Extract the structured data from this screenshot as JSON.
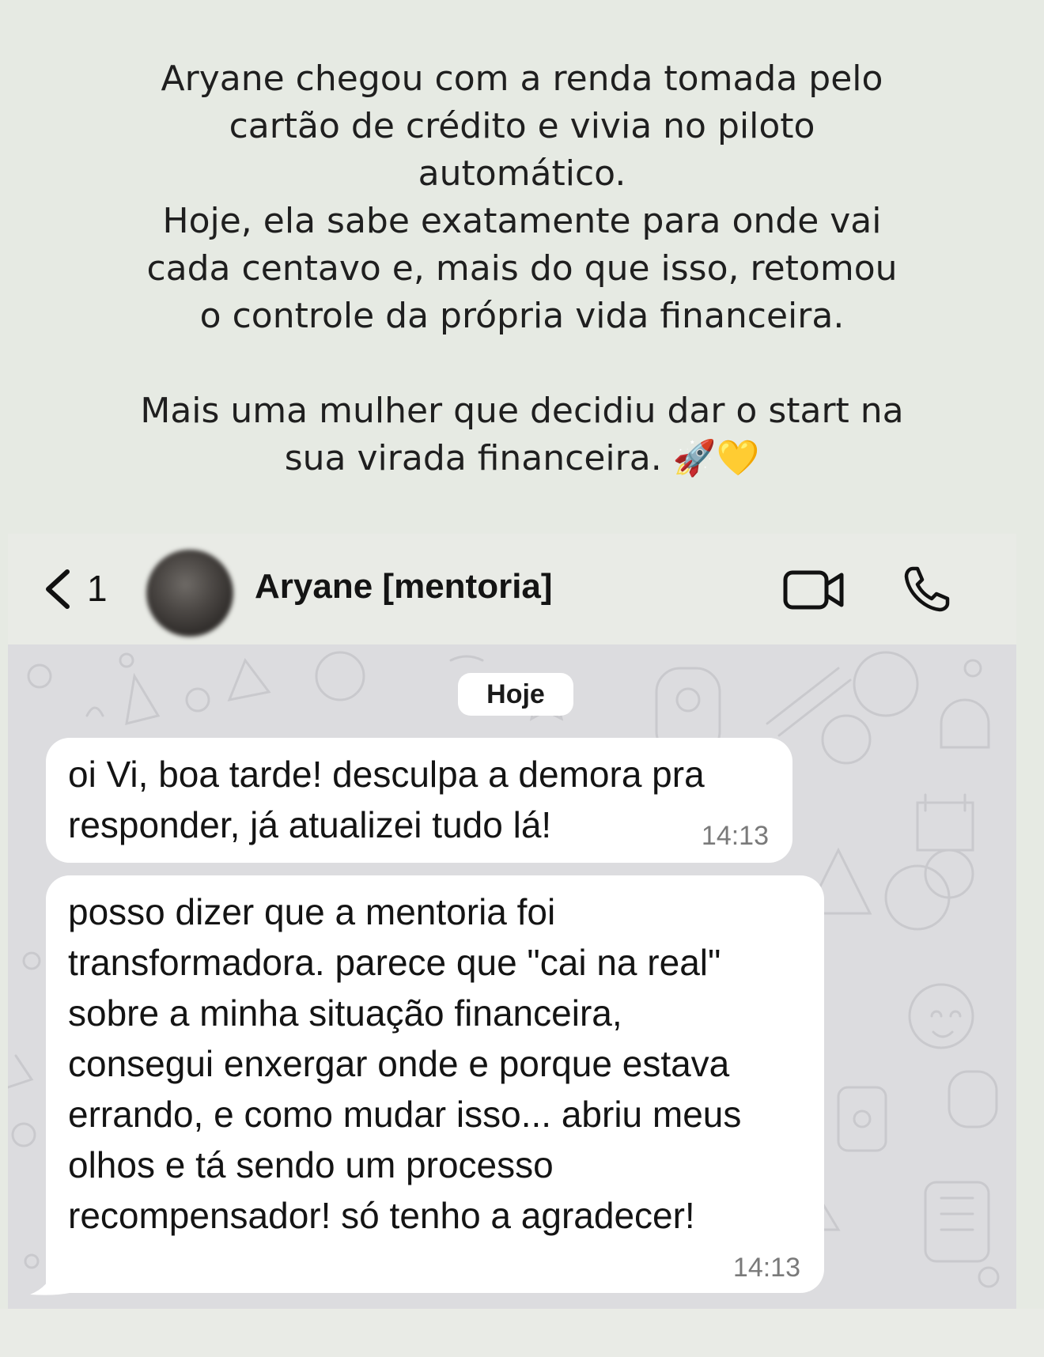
{
  "caption": {
    "para1_lines": [
      "Aryane chegou com a renda tomada pelo",
      "cartão de crédito e vivia no piloto",
      "automático.",
      "Hoje, ela sabe exatamente para onde vai",
      "cada centavo e, mais do que isso, retomou",
      "o controle da própria vida financeira."
    ],
    "para2_lines": [
      "Mais uma mulher que decidiu dar o start na",
      "sua virada financeira. 🚀💛"
    ]
  },
  "header": {
    "back_count": "1",
    "contact_name": "Aryane [mentoria]",
    "icons": [
      "chevron-left-icon",
      "avatar",
      "video-camera-icon",
      "phone-icon"
    ]
  },
  "chat": {
    "date_label": "Hoje",
    "messages": [
      {
        "text": "oi Vi, boa tarde! desculpa a demora pra\nresponder, já atualizei tudo lá!",
        "time": "14:13"
      },
      {
        "text": "posso dizer que a mentoria foi\ntransformadora. parece que \"cai na real\"\nsobre a minha situação financeira,\nconsegui enxergar onde e porque estava\nerrando, e como mudar isso... abriu meus\nolhos e tá sendo um processo\nrecompensador! só tenho a agradecer!",
        "time": "14:13"
      }
    ]
  },
  "colors": {
    "background": "#e6eae3",
    "chat_wallpaper": "#dcdcdf",
    "bubble": "#ffffff",
    "timestamp": "#7a7a7a"
  }
}
